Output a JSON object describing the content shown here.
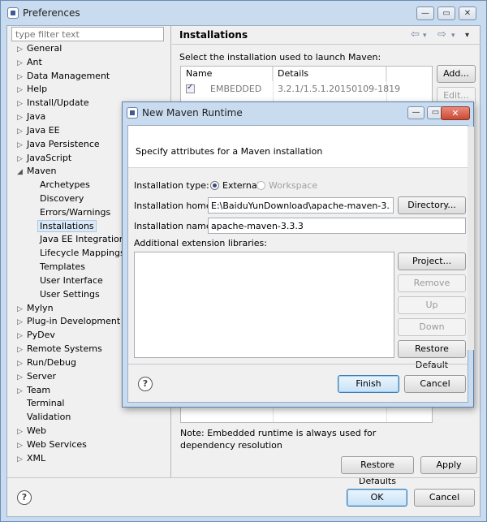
{
  "window": {
    "title": "Preferences",
    "min": "—",
    "max": "▭",
    "close": "✕"
  },
  "filter": {
    "placeholder": "type filter text"
  },
  "tree": [
    {
      "label": "General",
      "arrow": "▷"
    },
    {
      "label": "Ant",
      "arrow": "▷"
    },
    {
      "label": "Data Management",
      "arrow": "▷"
    },
    {
      "label": "Help",
      "arrow": "▷"
    },
    {
      "label": "Install/Update",
      "arrow": "▷"
    },
    {
      "label": "Java",
      "arrow": "▷"
    },
    {
      "label": "Java EE",
      "arrow": "▷"
    },
    {
      "label": "Java Persistence",
      "arrow": "▷"
    },
    {
      "label": "JavaScript",
      "arrow": "▷"
    },
    {
      "label": "Maven",
      "arrow": "◢"
    },
    {
      "label": "Archetypes",
      "arrow": ""
    },
    {
      "label": "Discovery",
      "arrow": ""
    },
    {
      "label": "Errors/Warnings",
      "arrow": ""
    },
    {
      "label": "Installations",
      "arrow": ""
    },
    {
      "label": "Java EE Integration",
      "arrow": ""
    },
    {
      "label": "Lifecycle Mappings",
      "arrow": ""
    },
    {
      "label": "Templates",
      "arrow": ""
    },
    {
      "label": "User Interface",
      "arrow": ""
    },
    {
      "label": "User Settings",
      "arrow": ""
    },
    {
      "label": "Mylyn",
      "arrow": "▷"
    },
    {
      "label": "Plug-in Development",
      "arrow": "▷"
    },
    {
      "label": "PyDev",
      "arrow": "▷"
    },
    {
      "label": "Remote Systems",
      "arrow": "▷"
    },
    {
      "label": "Run/Debug",
      "arrow": "▷"
    },
    {
      "label": "Server",
      "arrow": "▷"
    },
    {
      "label": "Team",
      "arrow": "▷"
    },
    {
      "label": "Terminal",
      "arrow": ""
    },
    {
      "label": "Validation",
      "arrow": ""
    },
    {
      "label": "Web",
      "arrow": "▷"
    },
    {
      "label": "Web Services",
      "arrow": "▷"
    },
    {
      "label": "XML",
      "arrow": "▷"
    }
  ],
  "page": {
    "title": "Installations",
    "nav_back": "⇦",
    "nav_back_menu": "▾",
    "nav_fwd": "⇨",
    "nav_fwd_menu": "▾",
    "view_menu": "▾",
    "description": "Select the installation used to launch Maven:",
    "col_name": "Name",
    "col_details": "Details",
    "rows": [
      {
        "name": "EMBEDDED",
        "details": "3.2.1/1.5.1.20150109-1819",
        "checked": true
      }
    ],
    "add_button": "Add...",
    "edit_button": "Edit...",
    "note": "Note: Embedded runtime is always used for dependency resolution",
    "restore_defaults": "Restore Defaults",
    "apply": "Apply"
  },
  "footer": {
    "help": "?",
    "ok": "OK",
    "cancel": "Cancel"
  },
  "dialog": {
    "title": "New Maven Runtime",
    "close": "✕",
    "min": "—",
    "max": "▭",
    "description": "Specify attributes for a Maven installation",
    "installation_type_label": "Installation type:",
    "type_external": "External",
    "type_workspace": "Workspace",
    "installation_home_label": "Installation home:",
    "installation_home_value": "E:\\BaiduYunDownload\\apache-maven-3.3.3",
    "directory_button": "Directory...",
    "installation_name_label": "Installation name:",
    "installation_name_value": "apache-maven-3.3.3",
    "ext_libs_label": "Additional extension libraries:",
    "project_button": "Project...",
    "remove_button": "Remove",
    "up_button": "Up",
    "down_button": "Down",
    "restore_default_button": "Restore Default",
    "help": "?",
    "finish": "Finish",
    "cancel": "Cancel"
  }
}
